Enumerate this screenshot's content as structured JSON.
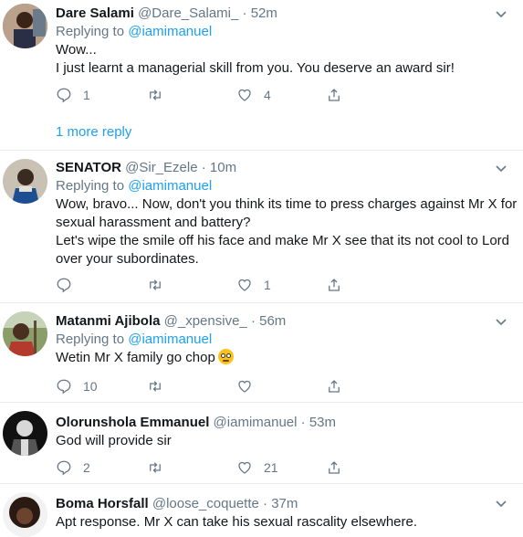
{
  "tweets": [
    {
      "name": "Dare Salami",
      "handle": "@Dare_Salami_",
      "sep": "·",
      "time": "52m",
      "replying_prefix": "Replying to",
      "replying_to": "@iamimanuel",
      "lines": [
        "Wow...",
        "I just learnt a managerial skill from you. You deserve an award sir!"
      ],
      "reply_count": "1",
      "retweet_count": "",
      "like_count": "4",
      "more_replies": "1 more reply"
    },
    {
      "name": "SENATOR",
      "handle": "@Sir_Ezele",
      "sep": "·",
      "time": "10m",
      "replying_prefix": "Replying to",
      "replying_to": "@iamimanuel",
      "lines": [
        "Wow, bravo... Now, don't you think its time to press charges against Mr X for",
        "sexual harassment and battery?",
        "Let's wipe the smile off his face and make Mr X see that its not cool to Lord",
        "over your subordinates."
      ],
      "reply_count": "",
      "retweet_count": "",
      "like_count": "1"
    },
    {
      "name": "Matanmi Ajibola",
      "handle": "@_xpensive_",
      "sep": "·",
      "time": "56m",
      "replying_prefix": "Replying to",
      "replying_to": "@iamimanuel",
      "lines": [
        "Wetin Mr X family go chop"
      ],
      "emoji": "rolling-eyes-emoji",
      "reply_count": "10",
      "retweet_count": "",
      "like_count": ""
    },
    {
      "name": "Olorunshola Emmanuel",
      "handle": "@iamimanuel",
      "sep": "·",
      "time": "53m",
      "lines": [
        "God will provide sir"
      ],
      "reply_count": "2",
      "retweet_count": "",
      "like_count": "21"
    },
    {
      "name": "Boma Horsfall",
      "handle": "@loose_coquette",
      "sep": "·",
      "time": "37m",
      "lines": [
        "Apt response. Mr X can take his sexual rascality elsewhere."
      ]
    }
  ],
  "colors": {
    "accent": "#1da1f2",
    "muted": "#657786",
    "text": "#14171a",
    "divider": "#e6ecf0"
  }
}
